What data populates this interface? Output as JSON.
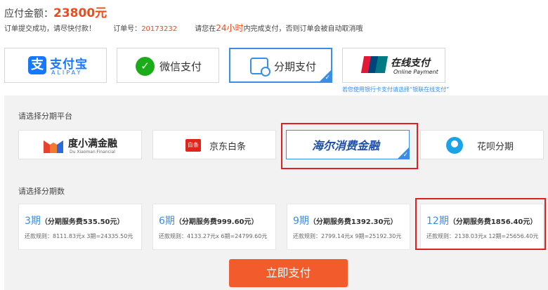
{
  "header": {
    "amount_label": "应付金额：",
    "amount_value": "23800元"
  },
  "order_info": {
    "success_text": "订单提交成功，请尽快付款！",
    "order_no_label": "订单号：",
    "order_no": "20173232",
    "deadline_prefix": "请您在",
    "deadline_hours": "24小时",
    "deadline_suffix": "内完成支付，否则订单会被自动取消哦"
  },
  "payment_methods": {
    "alipay_label": "支付宝",
    "alipay_en": "ALIPAY",
    "wechat_label": "微信支付",
    "installment_label": "分期支付",
    "unionpay_label": "在线支付",
    "unionpay_en": "Online Payment",
    "unionpay_hint": "若您使用银行卡支付请选择“银联在线支付”",
    "selected": "分期支付"
  },
  "platform_section": {
    "label": "请选择分期平台",
    "platforms": [
      {
        "name": "度小满金融",
        "sub": "Du Xiaoman Financial"
      },
      {
        "name": "京东白条",
        "badge": "白条"
      },
      {
        "name": "海尔消费金融"
      },
      {
        "name": "花呗分期"
      }
    ],
    "selected": "海尔消费金融"
  },
  "installment_section": {
    "label": "请选择分期数",
    "options": [
      {
        "period": "3期",
        "fee": "（分期服务费535.50元）",
        "rule": "还款规则：8111.83元x 3期=24335.50元"
      },
      {
        "period": "6期",
        "fee": "（分期服务费999.60元）",
        "rule": "还款规则：4133.27元x 6期=24799.60元"
      },
      {
        "period": "9期",
        "fee": "（分期服务费1392.30元）",
        "rule": "还款规则：2799.14元x 9期=25192.30元"
      },
      {
        "period": "12期",
        "fee": "（分期服务费1856.40元）",
        "rule": "还款规则：2138.03元x 12期=25656.40元"
      }
    ],
    "selected": "12期"
  },
  "submit_label": "立即支付",
  "colors": {
    "accent_blue": "#3a8ee6",
    "price_red": "#f04a1a",
    "submit_orange": "#f25b2c",
    "highlight_red": "#e02020"
  }
}
